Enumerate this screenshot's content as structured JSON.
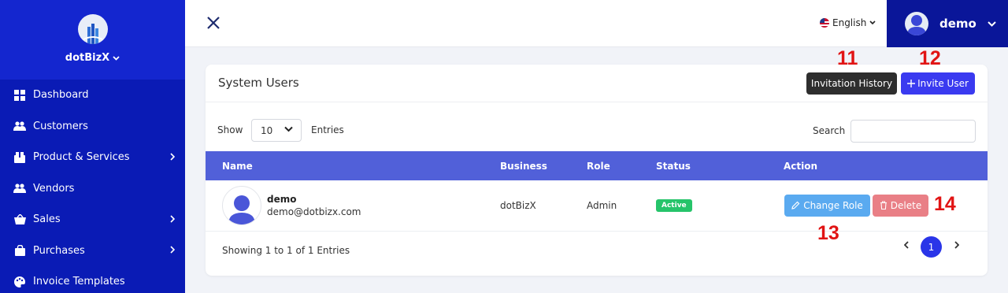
{
  "sidebar": {
    "brand": "dotBizX",
    "items": [
      {
        "label": "Dashboard",
        "icon": "grid-icon",
        "has_submenu": false
      },
      {
        "label": "Customers",
        "icon": "users-icon",
        "has_submenu": false
      },
      {
        "label": "Product & Services",
        "icon": "box-icon",
        "has_submenu": true
      },
      {
        "label": "Vendors",
        "icon": "users-icon",
        "has_submenu": false
      },
      {
        "label": "Sales",
        "icon": "basket-icon",
        "has_submenu": true
      },
      {
        "label": "Purchases",
        "icon": "bag-icon",
        "has_submenu": true
      },
      {
        "label": "Invoice Templates",
        "icon": "palette-icon",
        "has_submenu": false
      }
    ]
  },
  "topbar": {
    "language": "English",
    "user_name": "demo"
  },
  "card": {
    "title": "System Users",
    "invitation_history_label": "Invitation History",
    "invite_user_label": "Invite User",
    "show_label": "Show",
    "page_size": "10",
    "entries_label": "Entries",
    "search_label": "Search",
    "search_value": ""
  },
  "table": {
    "columns": [
      "Name",
      "Business",
      "Role",
      "Status",
      "Action"
    ],
    "rows": [
      {
        "name": "demo",
        "email": "demo@dotbizx.com",
        "business": "dotBizX",
        "role": "Admin",
        "status": "Active",
        "change_role_label": "Change Role",
        "delete_label": "Delete"
      }
    ]
  },
  "footer": {
    "summary": "Showing 1 to 1 of 1 Entries",
    "current_page": "1"
  },
  "annotations": [
    "11",
    "12",
    "13",
    "14"
  ],
  "colors": {
    "sidebar": "#0a1bb5",
    "sidebar_brand": "#1426cf",
    "user_box": "#0a1699",
    "table_header": "#5160d9",
    "invite_button": "#3a3af0",
    "history_button": "#2e2e2e",
    "change_role_button": "#5aaaf0",
    "delete_button": "#e97f86",
    "active_badge": "#26c46a",
    "annotation": "#e11414"
  }
}
